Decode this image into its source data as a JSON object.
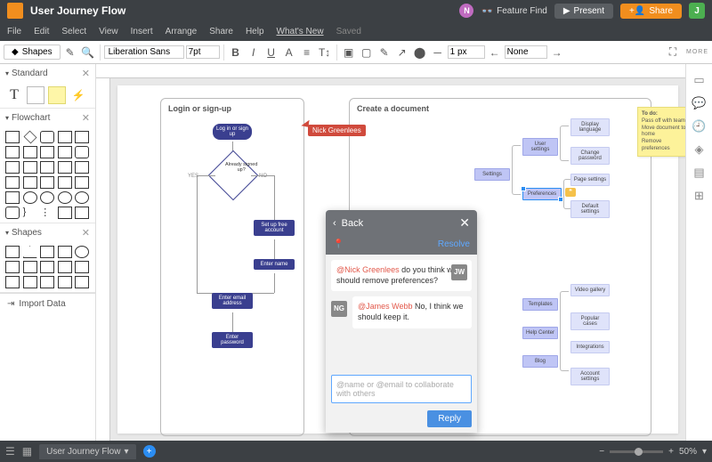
{
  "title": "User Journey Flow",
  "menubar": [
    "File",
    "Edit",
    "Select",
    "View",
    "Insert",
    "Arrange",
    "Share",
    "Help"
  ],
  "whats_new": "What's New",
  "saved": "Saved",
  "feature_find": "Feature Find",
  "present": "Present",
  "share": "Share",
  "avatar_n": "N",
  "avatar_j": "J",
  "toolbar": {
    "shapes": "Shapes",
    "font": "Liberation Sans",
    "size": "7pt",
    "bold": "B",
    "italic": "I",
    "underline": "U",
    "line_width": "1 px",
    "none": "None",
    "more": "MORE"
  },
  "panels": {
    "standard": "Standard",
    "flowchart": "Flowchart",
    "shapes": "Shapes",
    "import": "Import Data"
  },
  "pane1": {
    "title": "Login or sign-up",
    "n1": "Log in or sign up",
    "d1": "Already signed up?",
    "yes": "YES",
    "no": "NO",
    "n2": "Set up free account",
    "n3": "Enter name",
    "n4": "Enter email address",
    "n5": "Enter password"
  },
  "pane2": {
    "title": "Create a document",
    "settings": "Settings",
    "user_settings": "User settings",
    "preferences": "Preferences",
    "display_lang": "Display language",
    "change_pw": "Change password",
    "page_settings": "Page settings",
    "default_settings": "Default settings",
    "templates": "Templates",
    "help_center": "Help Center",
    "blog": "Blog",
    "video_gallery": "Video gallery",
    "popular_cases": "Popular cases",
    "integrations": "Integrations",
    "account_settings": "Account settings"
  },
  "sticky": {
    "title": "To do:",
    "l1": "Pass off with team",
    "l2": "Move document to home",
    "l3": "Remove preferences"
  },
  "cursor_user": "Nick Greenlees",
  "comments": {
    "back": "Back",
    "resolve": "Resolve",
    "m1_mention": "@Nick Greenlees",
    "m1_text": " do you think we should remove preferences?",
    "m1_av": "JW",
    "m2_av": "NG",
    "m2_mention": "@James Webb",
    "m2_text": " No, I think we should keep it.",
    "placeholder": "@name or @email to collaborate with others",
    "reply": "Reply"
  },
  "bottom": {
    "tab": "User Journey Flow",
    "zoom": "50%"
  }
}
